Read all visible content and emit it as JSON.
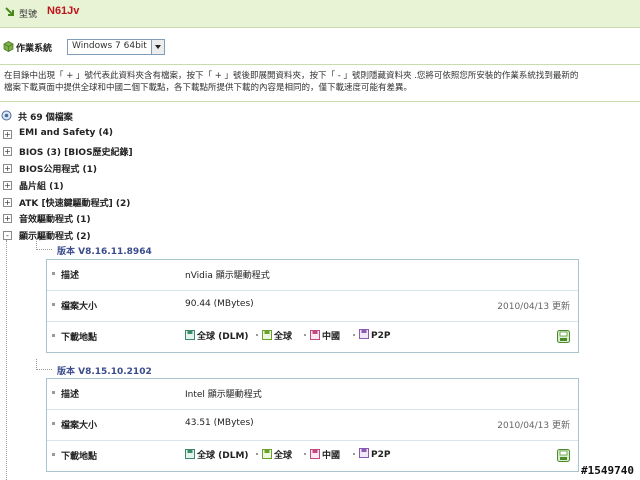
{
  "header": {
    "model_label": "型號",
    "model_value": "N61Jv"
  },
  "os": {
    "label": "作業系統",
    "selected": "Windows 7 64bit"
  },
  "description": {
    "line1": "在目錄中出現「 + 」號代表此資料夾含有檔案，按下「 + 」號後即展開資料夾，按下「 - 」號則隱藏資料夾 .您將可依照您所安裝的作業系統找到最新的",
    "line2": "檔案下載頁面中提供全球和中國二個下載點，各下載點所提供下載的內容是相同的，僅下載速度可能有差異。"
  },
  "total": "共 69 個檔案",
  "categories": [
    {
      "label": "EMI and Safety  (4)",
      "sign": "+"
    },
    {
      "label": "BIOS  (3)  [BIOS歷史紀錄]",
      "sign": "+"
    },
    {
      "label": "BIOS公用程式  (1)",
      "sign": "+"
    },
    {
      "label": "晶片組  (1)",
      "sign": "+"
    },
    {
      "label": "ATK [快速鍵驅動程式]  (2)",
      "sign": "+"
    },
    {
      "label": "音效驅動程式  (1)",
      "sign": "+"
    },
    {
      "label": "顯示驅動程式  (2)",
      "sign": "-"
    }
  ],
  "labels": {
    "desc": "描述",
    "size": "檔案大小",
    "download": "下載地點"
  },
  "versions": [
    {
      "version": "版本 V8.16.11.8964",
      "description": "nVidia 顯示驅動程式",
      "size": "90.44 (MBytes)",
      "date": "2010/04/13 更新",
      "links": [
        "全球 (DLM)",
        "全球",
        "中國",
        "P2P"
      ]
    },
    {
      "version": "版本 V8.15.10.2102",
      "description": "Intel 顯示驅動程式",
      "size": "43.51 (MBytes)",
      "date": "2010/04/13 更新",
      "links": [
        "全球 (DLM)",
        "全球",
        "中國",
        "P2P"
      ]
    }
  ],
  "watermark": "#1549740",
  "colors": {
    "header_bg": "#e8f2d4",
    "model_red": "#c0141b",
    "version_blue": "#3a4c8c",
    "panel_border": "#a8c4cf"
  }
}
